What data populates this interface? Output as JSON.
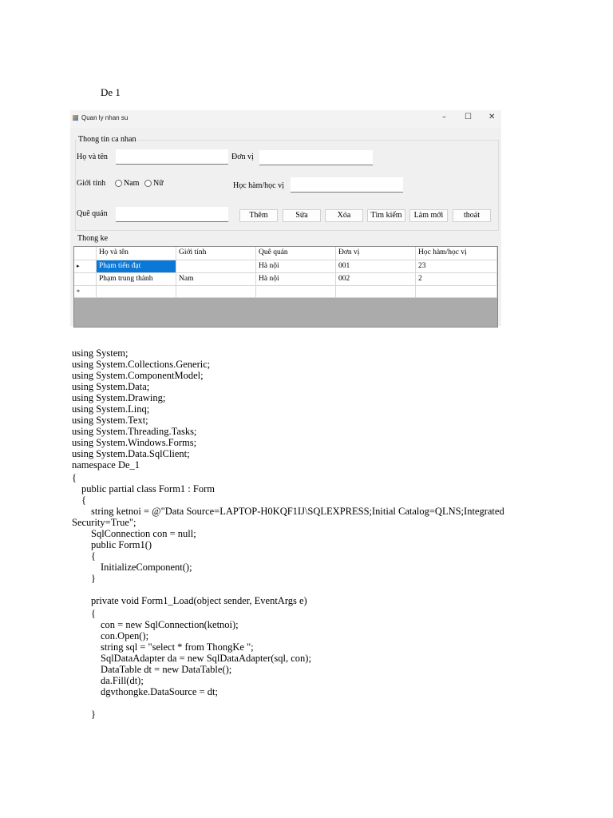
{
  "heading": "De 1",
  "window": {
    "title": "Quan ly nhan su",
    "minimize": "–",
    "maximize": "☐",
    "close": "✕"
  },
  "personal": {
    "group_label": "Thong tin ca nhan",
    "name_label": "Họ và tên",
    "unit_label": "Đơn vị",
    "gender_label": "Giới tính",
    "male": "Nam",
    "female": "Nữ",
    "degree_label": "Học hàm/học vị",
    "hometown_label": "Quê quán",
    "name_value": "",
    "unit_value": "",
    "degree_value": "",
    "hometown_value": ""
  },
  "buttons": {
    "add": "Thêm",
    "edit": "Sửa",
    "delete": "Xóa",
    "search": "Tìm kiếm",
    "refresh": "Làm mới",
    "exit": "thoát"
  },
  "stats": {
    "group_label": "Thong ke",
    "columns": [
      "Họ và tên",
      "Giới tính",
      "Quê quán",
      "Đơn vị",
      "Học hàm/học vị"
    ],
    "rows": [
      [
        "Phạm tiến đạt",
        "",
        "Hà nội",
        "001",
        "23"
      ],
      [
        "Phạm trung thành",
        "Nam",
        "Hà nội",
        "002",
        "2"
      ]
    ],
    "current_marker": "▸",
    "new_marker": "*"
  },
  "code": [
    "using System;",
    "using System.Collections.Generic;",
    "using System.ComponentModel;",
    "using System.Data;",
    "using System.Drawing;",
    "using System.Linq;",
    "using System.Text;",
    "using System.Threading.Tasks;",
    "using System.Windows.Forms;",
    "using System.Data.SqlClient;",
    "namespace De_1",
    "{",
    "public partial class Form1 : Form",
    "{",
    "string ketnoi = @\"Data Source=LAPTOP-H0KQF1IJ\\SQLEXPRESS;Initial Catalog=QLNS;Integrated",
    "Security=True\";",
    "SqlConnection con = null;",
    "public Form1()",
    "{",
    "InitializeComponent();",
    "}",
    "private void Form1_Load(object sender, EventArgs e)",
    "{",
    "con = new SqlConnection(ketnoi);",
    "con.Open();",
    "string sql = \"select * from ThongKe \";",
    "SqlDataAdapter da = new SqlDataAdapter(sql, con);",
    "DataTable dt = new DataTable();",
    "da.Fill(dt);",
    "dgvthongke.DataSource = dt;",
    "}"
  ]
}
